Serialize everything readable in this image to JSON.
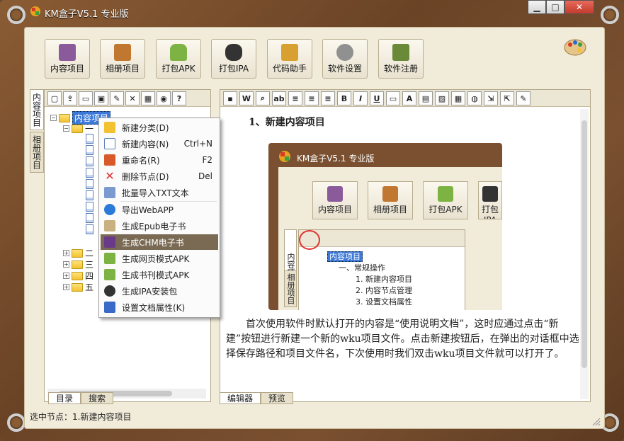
{
  "window": {
    "title": "KM盒子V5.1 专业版",
    "min": "▁",
    "max": "□",
    "close": "✕"
  },
  "toolbar": [
    {
      "label": "内容项目",
      "color": "#8b5a9a"
    },
    {
      "label": "相册项目",
      "color": "#c07830"
    },
    {
      "label": "打包APK",
      "color": "#7cb342"
    },
    {
      "label": "打包IPA",
      "color": "#333333"
    },
    {
      "label": "代码助手",
      "color": "#d8a030"
    },
    {
      "label": "软件设置",
      "color": "#909090"
    },
    {
      "label": "软件注册",
      "color": "#6a8a3a"
    }
  ],
  "left_tabs": [
    "内容项目",
    "相册项目"
  ],
  "tree": {
    "root": "内容项目",
    "child_first": "一",
    "collapsed": [
      "二",
      "三",
      "四",
      "五"
    ]
  },
  "context_menu": [
    {
      "label": "新建分类(D)",
      "shortcut": "",
      "icon_color": "#f2c231"
    },
    {
      "label": "新建内容(N)",
      "shortcut": "Ctrl+N",
      "icon_color": "#ffffff"
    },
    {
      "label": "重命名(R)",
      "shortcut": "F2",
      "icon_color": "#d85a2a"
    },
    {
      "label": "删除节点(D)",
      "shortcut": "Del",
      "icon_color": "#e03030"
    },
    {
      "label": "批量导入TXT文本",
      "shortcut": "",
      "icon_color": "#7a9ad0"
    },
    {
      "label": "导出WebAPP",
      "shortcut": "",
      "icon_color": "#2a7ad8"
    },
    {
      "label": "生成Epub电子书",
      "shortcut": "",
      "icon_color": "#c9b080"
    },
    {
      "label": "生成CHM电子书",
      "shortcut": "",
      "icon_color": "#6a3a8a"
    },
    {
      "label": "生成网页模式APK",
      "shortcut": "",
      "icon_color": "#7cb342"
    },
    {
      "label": "生成书刊模式APK",
      "shortcut": "",
      "icon_color": "#7cb342"
    },
    {
      "label": "生成IPA安装包",
      "shortcut": "",
      "icon_color": "#333333"
    },
    {
      "label": "设置文档属性(K)",
      "shortcut": "",
      "icon_color": "#3a6ac8"
    }
  ],
  "left_bottom_tabs": [
    "目录",
    "搜索"
  ],
  "right_bottom_tabs": [
    "编辑器",
    "预览"
  ],
  "doc": {
    "heading": "1、新建内容项目",
    "paragraph": "首次使用软件时默认打开的内容是“使用说明文档”，这时应通过点击“新建”按钮进行新建一个新的wku项目文件。点击新建按钮后，在弹出的对话框中选择保存路径和项目文件名，下次使用时我们双击wku项目文件就可以打开了。",
    "screenshot": {
      "title": "KM盒子V5.1 专业版",
      "buttons": [
        "内容项目",
        "相册项目",
        "打包APK",
        "打包IPA"
      ],
      "tabs": [
        "内容项目",
        "相册项目"
      ],
      "tree": [
        "内容项目",
        "一、常规操作",
        "1. 新建内容项目",
        "2. 内容节点管理",
        "3. 设置文档属性"
      ]
    }
  },
  "status": "选中节点：1.新建内容项目",
  "colors": {
    "frame": "#6a4326",
    "paper": "#f1ebda",
    "accent": "#3b78d8",
    "menu_highlight": "#7a6a54"
  }
}
